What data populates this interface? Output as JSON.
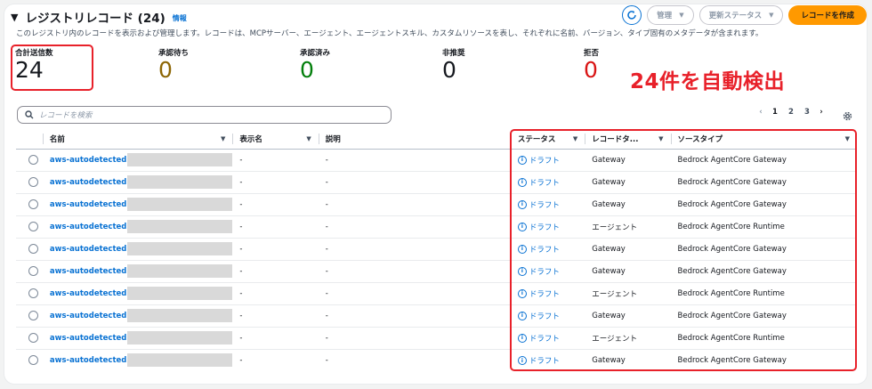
{
  "header": {
    "title": "レジストリレコード (24)",
    "info_link": "情報",
    "description": "このレジストリ内のレコードを表示および管理します。レコードは、MCPサーバー、エージェント、エージェントスキル、カスタムリソースを表し、それぞれに名前、バージョン、タイプ固有のメタデータが含まれます。"
  },
  "actions": {
    "refresh_icon": "refresh-icon",
    "manage_label": "管理",
    "update_status_label": "更新ステータス",
    "create_label": "レコードを作成"
  },
  "metrics": {
    "total": {
      "label": "合計送信数",
      "value": "24"
    },
    "pending": {
      "label": "承認待ち",
      "value": "0"
    },
    "approved": {
      "label": "承認済み",
      "value": "0"
    },
    "deprecated": {
      "label": "非推奨",
      "value": "0"
    },
    "rejected": {
      "label": "拒否",
      "value": "0"
    }
  },
  "annotation": {
    "text": "24件を自動検出"
  },
  "search": {
    "placeholder": "レコードを検索"
  },
  "pagination": {
    "prev": "‹",
    "pages": [
      "1",
      "2",
      "3"
    ],
    "current": "1",
    "next": "›"
  },
  "table": {
    "columns": [
      "名前",
      "表示名",
      "説明",
      "ステータス",
      "レコードタ...",
      "ソースタイプ"
    ],
    "rows": [
      {
        "name": "aws-autodetected",
        "display_name": "-",
        "description": "-",
        "status": "ドラフト",
        "record_type": "Gateway",
        "source_type": "Bedrock AgentCore Gateway"
      },
      {
        "name": "aws-autodetected",
        "display_name": "-",
        "description": "-",
        "status": "ドラフト",
        "record_type": "Gateway",
        "source_type": "Bedrock AgentCore Gateway"
      },
      {
        "name": "aws-autodetected",
        "display_name": "-",
        "description": "-",
        "status": "ドラフト",
        "record_type": "Gateway",
        "source_type": "Bedrock AgentCore Gateway"
      },
      {
        "name": "aws-autodetected",
        "display_name": "-",
        "description": "-",
        "status": "ドラフト",
        "record_type": "エージェント",
        "source_type": "Bedrock AgentCore Runtime"
      },
      {
        "name": "aws-autodetected",
        "display_name": "-",
        "description": "-",
        "status": "ドラフト",
        "record_type": "Gateway",
        "source_type": "Bedrock AgentCore Gateway"
      },
      {
        "name": "aws-autodetected",
        "display_name": "-",
        "description": "-",
        "status": "ドラフト",
        "record_type": "Gateway",
        "source_type": "Bedrock AgentCore Gateway"
      },
      {
        "name": "aws-autodetected",
        "display_name": "-",
        "description": "-",
        "status": "ドラフト",
        "record_type": "エージェント",
        "source_type": "Bedrock AgentCore Runtime"
      },
      {
        "name": "aws-autodetected",
        "display_name": "-",
        "description": "-",
        "status": "ドラフト",
        "record_type": "Gateway",
        "source_type": "Bedrock AgentCore Gateway"
      },
      {
        "name": "aws-autodetected",
        "display_name": "-",
        "description": "-",
        "status": "ドラフト",
        "record_type": "エージェント",
        "source_type": "Bedrock AgentCore Runtime"
      },
      {
        "name": "aws-autodetected",
        "display_name": "-",
        "description": "-",
        "status": "ドラフト",
        "record_type": "Gateway",
        "source_type": "Bedrock AgentCore Gateway"
      }
    ]
  },
  "colors": {
    "accent": "#0972d3",
    "primary_button": "#ff9900",
    "annotation": "#e8212a",
    "pending": "#8d6605",
    "approved": "#037f0c",
    "rejected": "#d91515"
  }
}
